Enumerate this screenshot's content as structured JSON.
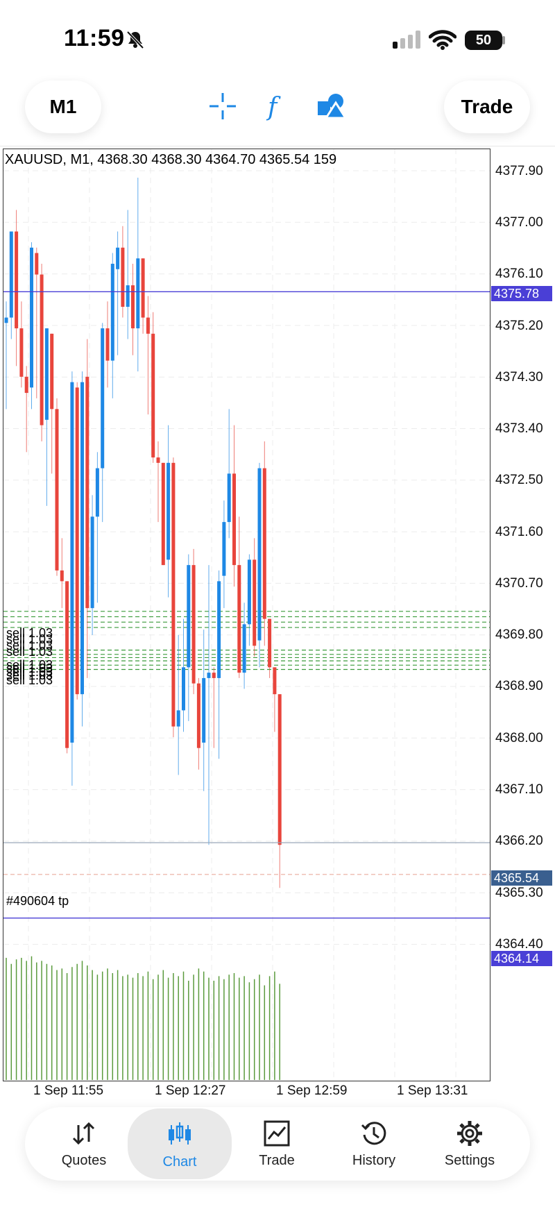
{
  "status": {
    "time": "11:59",
    "battery": "50"
  },
  "toolbar": {
    "timeframe": "M1",
    "trade": "Trade"
  },
  "chart": {
    "info": "XAUUSD, M1, 4368.30 4368.30 4364.70 4365.54 159",
    "price_labels": [
      "4377.90",
      "4377.00",
      "4376.10",
      "4375.20",
      "4374.30",
      "4373.40",
      "4372.50",
      "4371.60",
      "4370.70",
      "4369.80",
      "4368.90",
      "4368.00",
      "4367.10",
      "4366.20",
      "4365.30",
      "4364.40"
    ],
    "tags": {
      "upper_line": "4375.78",
      "current": "4365.54",
      "lower_line": "4364.14"
    },
    "time_labels": [
      "1 Sep 11:55",
      "1 Sep 12:27",
      "1 Sep 12:59",
      "1 Sep 13:31"
    ],
    "orders": [
      "sell 1.03",
      "sell 1.03",
      "sell 1.03",
      "sell 1.03",
      "sell 1.03",
      "sell 1.03",
      "sell 1.03",
      "sell 1.03",
      "sell 1.03"
    ],
    "tp_label": "#490604 tp",
    "colors": {
      "bull": "#1e88e5",
      "bear": "#e8453c",
      "volume": "#5a9a3c",
      "hline": "#4a3fd6",
      "order": "#3a9a3a"
    }
  },
  "chart_data": {
    "type": "candlestick",
    "symbol": "XAUUSD",
    "timeframe": "M1",
    "ylim": [
      4363.4,
      4378.3
    ],
    "x_ticks": [
      "1 Sep 11:55",
      "1 Sep 12:27",
      "1 Sep 12:59",
      "1 Sep 13:31"
    ],
    "candles": [
      [
        4375.2,
        4375.6,
        4373.6,
        4375.3
      ],
      [
        4375.3,
        4376.9,
        4374.9,
        4376.9
      ],
      [
        4376.9,
        4377.3,
        4374.4,
        4375.1
      ],
      [
        4375.1,
        4375.6,
        4374.0,
        4374.2
      ],
      [
        4374.2,
        4374.4,
        4372.8,
        4373.9
      ],
      [
        4374.0,
        4376.7,
        4373.6,
        4376.6
      ],
      [
        4376.5,
        4376.6,
        4373.8,
        4376.1
      ],
      [
        4376.1,
        4376.3,
        4373.0,
        4373.3
      ],
      [
        4373.4,
        4375.1,
        4371.8,
        4375.1
      ],
      [
        4375.0,
        4375.0,
        4372.4,
        4373.6
      ],
      [
        4373.6,
        4373.8,
        4370.5,
        4370.6
      ],
      [
        4370.6,
        4371.2,
        4369.9,
        4370.4
      ],
      [
        4370.4,
        4370.4,
        4367.2,
        4367.3
      ],
      [
        4367.4,
        4374.3,
        4366.6,
        4374.1
      ],
      [
        4374.0,
        4374.1,
        4368.2,
        4368.3
      ],
      [
        4368.3,
        4374.3,
        4367.7,
        4374.1
      ],
      [
        4374.2,
        4374.9,
        4368.6,
        4369.9
      ],
      [
        4369.9,
        4372.0,
        4369.4,
        4371.6
      ],
      [
        4371.6,
        4372.8,
        4370.0,
        4372.5
      ],
      [
        4372.5,
        4375.2,
        4371.5,
        4375.1
      ],
      [
        4375.1,
        4375.6,
        4374.0,
        4374.5
      ],
      [
        4374.5,
        4376.5,
        4373.8,
        4376.3
      ],
      [
        4376.2,
        4376.9,
        4374.6,
        4376.6
      ],
      [
        4376.6,
        4377.0,
        4375.3,
        4375.5
      ],
      [
        4375.5,
        4377.3,
        4374.9,
        4375.9
      ],
      [
        4375.9,
        4376.3,
        4374.6,
        4375.1
      ],
      [
        4375.1,
        4377.9,
        4374.3,
        4376.4
      ],
      [
        4376.4,
        4376.4,
        4375.0,
        4375.3
      ],
      [
        4375.3,
        4375.7,
        4373.5,
        4375.0
      ],
      [
        4375.0,
        4375.4,
        4372.6,
        4372.7
      ],
      [
        4372.7,
        4373.0,
        4371.5,
        4372.6
      ],
      [
        4372.6,
        4372.6,
        4370.7,
        4370.7
      ],
      [
        4370.8,
        4373.3,
        4370.1,
        4372.6
      ],
      [
        4372.6,
        4372.7,
        4367.5,
        4367.7
      ],
      [
        4367.7,
        4369.4,
        4366.8,
        4368.0
      ],
      [
        4368.0,
        4369.7,
        4367.6,
        4368.8
      ],
      [
        4368.8,
        4370.9,
        4367.8,
        4370.7
      ],
      [
        4370.7,
        4371.0,
        4368.3,
        4368.5
      ],
      [
        4368.5,
        4368.6,
        4366.9,
        4367.3
      ],
      [
        4367.4,
        4369.5,
        4366.5,
        4368.6
      ],
      [
        4368.6,
        4370.7,
        4365.5,
        4368.7
      ],
      [
        4368.7,
        4368.8,
        4367.3,
        4368.6
      ],
      [
        4368.6,
        4370.6,
        4367.1,
        4370.4
      ],
      [
        4370.5,
        4371.9,
        4369.9,
        4371.5
      ],
      [
        4371.5,
        4373.6,
        4371.2,
        4372.4
      ],
      [
        4372.4,
        4373.3,
        4370.3,
        4370.7
      ],
      [
        4370.7,
        4371.6,
        4368.6,
        4368.7
      ],
      [
        4368.7,
        4370.0,
        4368.4,
        4369.6
      ],
      [
        4369.6,
        4370.9,
        4369.2,
        4370.8
      ],
      [
        4370.8,
        4371.2,
        4369.0,
        4369.2
      ],
      [
        4369.3,
        4372.6,
        4368.8,
        4372.5
      ],
      [
        4372.5,
        4373.0,
        4369.2,
        4369.7
      ],
      [
        4369.7,
        4369.7,
        4368.6,
        4368.8
      ],
      [
        4368.8,
        4368.8,
        4367.6,
        4368.3
      ],
      [
        4368.3,
        4368.3,
        4364.7,
        4365.5
      ]
    ],
    "volume": [
      80,
      76,
      79,
      80,
      78,
      81,
      77,
      78,
      76,
      75,
      72,
      73,
      70,
      74,
      76,
      78,
      75,
      72,
      69,
      71,
      73,
      70,
      72,
      68,
      69,
      67,
      70,
      68,
      71,
      66,
      69,
      72,
      67,
      70,
      68,
      71,
      65,
      69,
      73,
      71,
      67,
      65,
      68,
      66,
      69,
      70,
      67,
      68,
      64,
      66,
      69,
      62,
      68,
      71,
      63
    ],
    "horizontal_lines": [
      {
        "price": 4375.78,
        "label": "4375.78"
      },
      {
        "price": 4364.14,
        "label": "4364.14"
      },
      {
        "price": 4365.54,
        "label": "4365.54",
        "kind": "current-price"
      },
      {
        "price": 4364.95,
        "label": "#490604 tp",
        "kind": "take-profit"
      }
    ],
    "order_lines": [
      4369.84,
      4369.74,
      4369.64,
      4369.54,
      4369.12,
      4369.04,
      4368.98,
      4368.92,
      4368.84,
      4368.76
    ]
  },
  "tabs": [
    {
      "label": "Quotes",
      "icon": "quotes-icon"
    },
    {
      "label": "Chart",
      "icon": "chart-icon"
    },
    {
      "label": "Trade",
      "icon": "trade-icon"
    },
    {
      "label": "History",
      "icon": "history-icon"
    },
    {
      "label": "Settings",
      "icon": "settings-icon"
    }
  ]
}
